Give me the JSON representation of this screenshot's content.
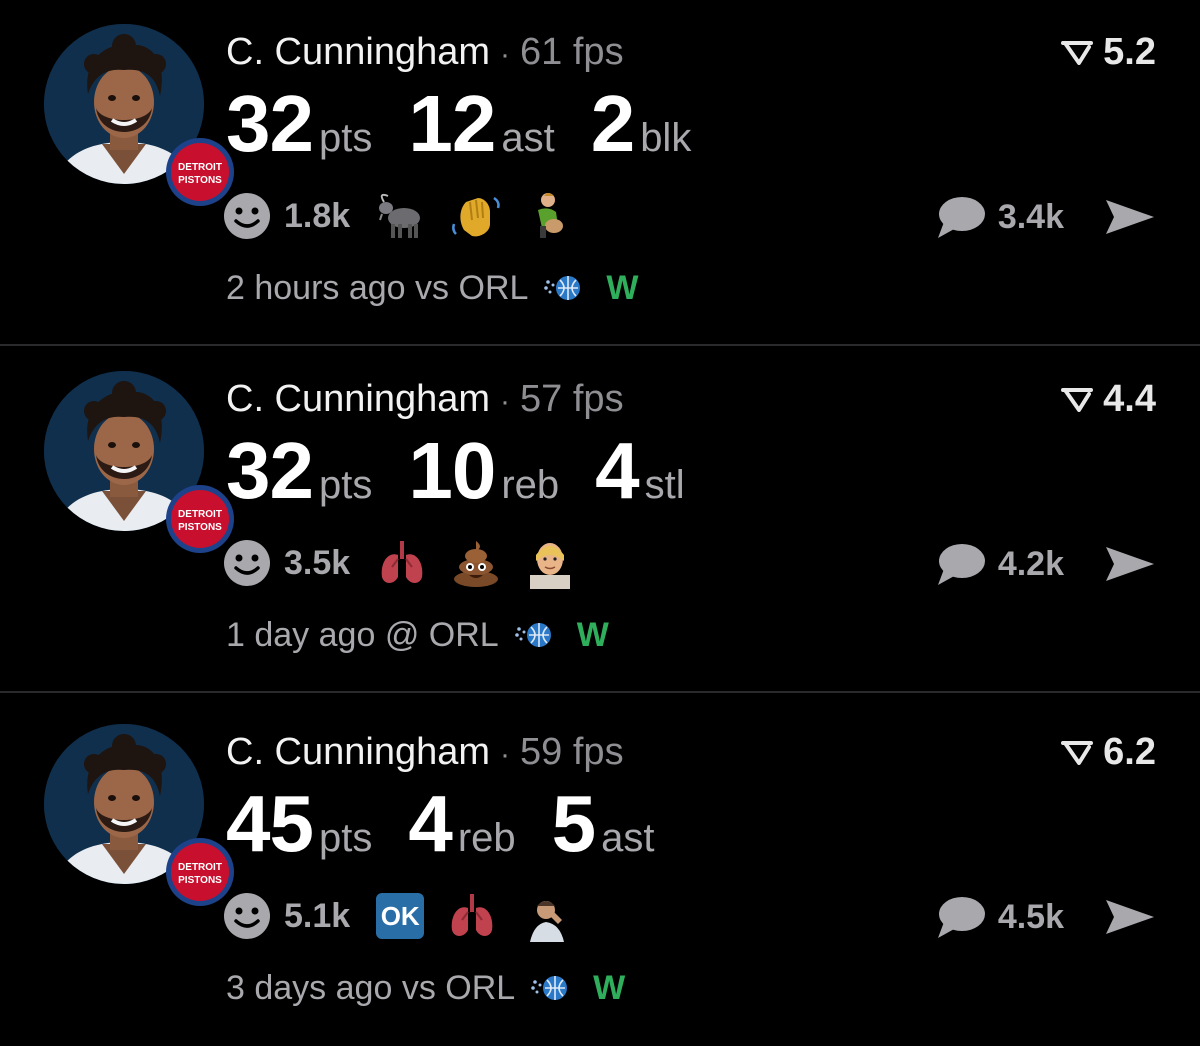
{
  "posts": [
    {
      "player": "C. Cunningham",
      "separator": "·",
      "fps": "61 fps",
      "rating": "5.2",
      "stats": [
        {
          "value": "32",
          "unit": "pts"
        },
        {
          "value": "12",
          "unit": "ast"
        },
        {
          "value": "2",
          "unit": "blk"
        }
      ],
      "reaction_count": "1.8k",
      "reaction_emojis": [
        "goat-emoji",
        "waving-hand-emoji",
        "person-emoji"
      ],
      "comment_count": "3.4k",
      "time": "2 hours ago",
      "matchup": "vs ORL",
      "result": "W"
    },
    {
      "player": "C. Cunningham",
      "separator": "·",
      "fps": "57 fps",
      "rating": "4.4",
      "stats": [
        {
          "value": "32",
          "unit": "pts"
        },
        {
          "value": "10",
          "unit": "reb"
        },
        {
          "value": "4",
          "unit": "stl"
        }
      ],
      "reaction_count": "3.5k",
      "reaction_emojis": [
        "lungs-emoji",
        "poop-emoji",
        "blonde-person-emoji"
      ],
      "comment_count": "4.2k",
      "time": "1 day ago",
      "matchup": "@ ORL",
      "result": "W"
    },
    {
      "player": "C. Cunningham",
      "separator": "·",
      "fps": "59 fps",
      "rating": "6.2",
      "stats": [
        {
          "value": "45",
          "unit": "pts"
        },
        {
          "value": "4",
          "unit": "reb"
        },
        {
          "value": "5",
          "unit": "ast"
        }
      ],
      "reaction_count": "5.1k",
      "reaction_emojis": [
        "ok-button-emoji",
        "lungs-emoji",
        "player-photo-emoji"
      ],
      "ok_label": "OK",
      "comment_count": "4.5k",
      "time": "3 days ago",
      "matchup": "vs ORL",
      "result": "W"
    }
  ],
  "badge_text": {
    "line1": "DETROIT",
    "line2": "PISTONS"
  },
  "colors": {
    "background": "#000000",
    "muted_text": "#a8a8ad",
    "win_green": "#2fae5c",
    "pistons_red": "#c8102e",
    "pistons_blue": "#1d428a"
  }
}
